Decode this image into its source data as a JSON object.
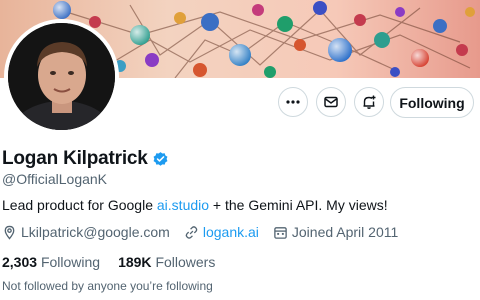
{
  "banner": {
    "description_icon": "banner-image"
  },
  "actions": {
    "more_icon": "more-icon",
    "message_icon": "message-icon",
    "notify_icon": "bell-plus-icon",
    "following_label": "Following"
  },
  "profile": {
    "name": "Logan Kilpatrick",
    "verified_icon": "verified-badge-icon",
    "handle": "@OfficialLoganK",
    "bio_before": "Lead product for Google ",
    "bio_link": "ai.studio",
    "bio_after": " + the Gemini API. My views!",
    "email": "Lkilpatrick@google.com",
    "website": "logank.ai",
    "joined": "Joined April 2011"
  },
  "stats": {
    "following_count": "2,303",
    "following_label": "Following",
    "followers_count": "189K",
    "followers_label": "Followers"
  },
  "followed_by_text": "Not followed by anyone you’re following",
  "colors": {
    "accent": "#1d9bf0",
    "text_primary": "#0f1419",
    "text_secondary": "#536471",
    "border": "#cfd9de"
  }
}
